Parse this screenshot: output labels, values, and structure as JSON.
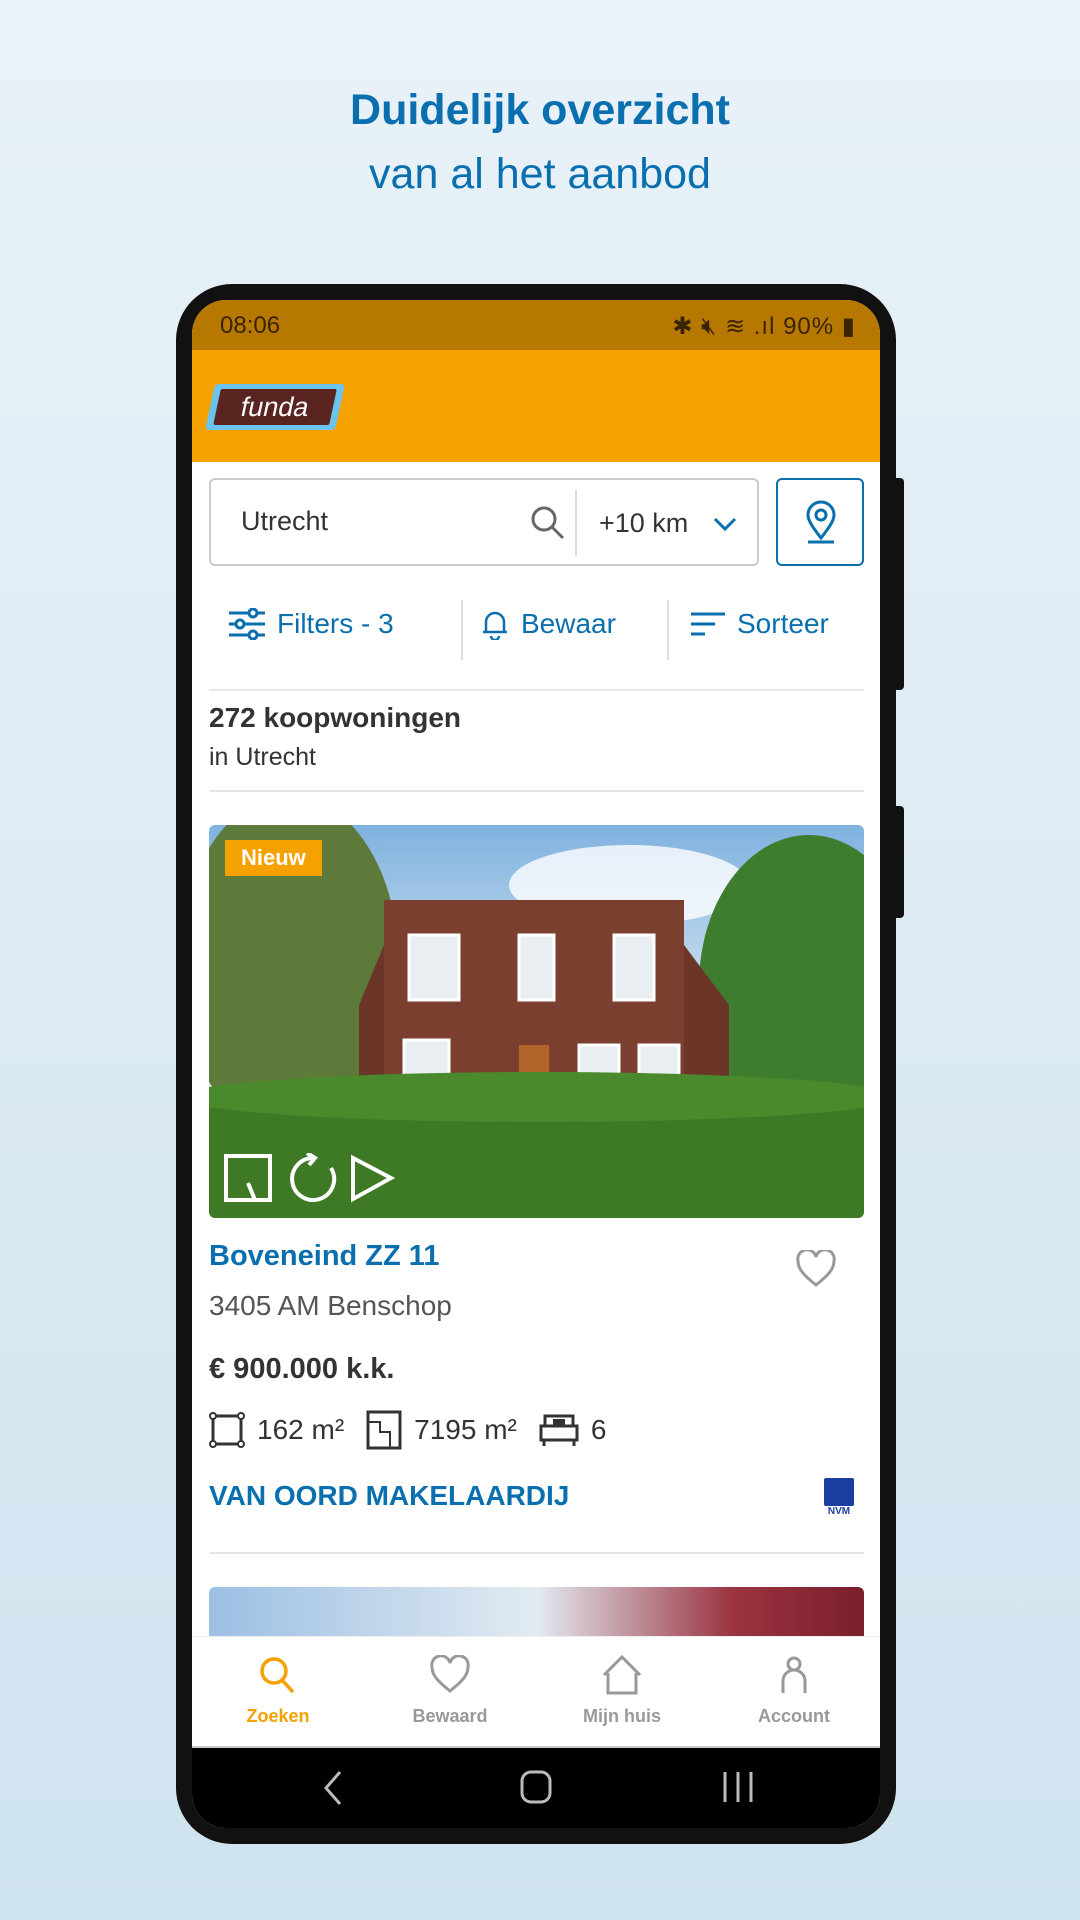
{
  "promo": {
    "title": "Duidelijk overzicht",
    "subtitle": "van al het aanbod"
  },
  "status_bar": {
    "time": "08:06",
    "battery": "90%",
    "icons": [
      "bluetooth-icon",
      "mute-icon",
      "wifi-icon",
      "signal-icon",
      "battery-icon"
    ]
  },
  "header": {
    "logo_text": "funda"
  },
  "search": {
    "value": "Utrecht",
    "radius": "+10 km"
  },
  "actions": {
    "filters": "Filters - 3",
    "save": "Bewaar",
    "sort": "Sorteer"
  },
  "results": {
    "count": "272 koopwoningen",
    "location": "in Utrecht"
  },
  "listings": [
    {
      "badge": "Nieuw",
      "title": "Boveneind ZZ 11",
      "address": "3405 AM Benschop",
      "price": "€ 900.000 k.k.",
      "living_area": "162 m²",
      "plot_area": "7195 m²",
      "rooms": "6",
      "agent": "VAN OORD MAKELAARDIJ",
      "agent_logo": "NVM"
    }
  ],
  "bottom_nav": [
    {
      "label": "Zoeken",
      "icon": "search-icon",
      "active": true
    },
    {
      "label": "Bewaard",
      "icon": "heart-icon",
      "active": false
    },
    {
      "label": "Mijn huis",
      "icon": "home-icon",
      "active": false
    },
    {
      "label": "Account",
      "icon": "user-icon",
      "active": false
    }
  ],
  "colors": {
    "brand_orange": "#f5a100",
    "link_blue": "#0a6fae",
    "inactive": "#999999"
  }
}
